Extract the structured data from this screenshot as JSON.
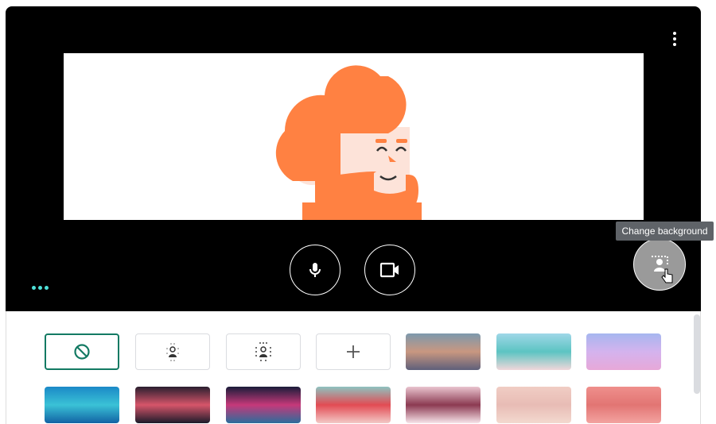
{
  "tooltip": "Change background",
  "icons": {
    "menu": "more-vert-icon",
    "mic": "microphone-icon",
    "camera": "video-camera-icon",
    "background": "change-background-icon",
    "cursor": "hand-cursor-icon"
  },
  "colors": {
    "accent": "#137a63",
    "avatar_orange": "#ff8142",
    "dots": "#4ee0d8"
  },
  "backgrounds": {
    "options": [
      {
        "name": "no-effect",
        "icon": "block-icon",
        "selected": true
      },
      {
        "name": "slight-blur",
        "icon": "blur-small-icon"
      },
      {
        "name": "blur",
        "icon": "blur-large-icon"
      },
      {
        "name": "upload",
        "icon": "plus-icon"
      }
    ],
    "row1_images": [
      {
        "name": "sunset-gradient",
        "colors": [
          "#7d99ad",
          "#c99780",
          "#5e5f7a"
        ]
      },
      {
        "name": "beach",
        "colors": [
          "#9fd7e8",
          "#5cc4c2",
          "#f0d7da"
        ]
      },
      {
        "name": "purple-clouds",
        "colors": [
          "#a6b6ef",
          "#d4b3ee",
          "#e7a8d8"
        ]
      }
    ],
    "row2_images": [
      {
        "name": "pool-water",
        "colors": [
          "#1b89c7",
          "#3ac2d6",
          "#1262a4"
        ]
      },
      {
        "name": "galaxy",
        "colors": [
          "#2a1f2f",
          "#d6556a",
          "#1b1b2a"
        ]
      },
      {
        "name": "fireworks",
        "colors": [
          "#1a1c3a",
          "#c6397a",
          "#2a6e9c"
        ]
      },
      {
        "name": "flowers",
        "colors": [
          "#8ec3c0",
          "#e24b53",
          "#f3c9c6"
        ]
      },
      {
        "name": "blossoms",
        "colors": [
          "#e9c4cf",
          "#8c3a52",
          "#f7e4ea"
        ]
      },
      {
        "name": "pink-sparkle",
        "colors": [
          "#f0cdc4",
          "#e8bcb5",
          "#f3d9cf"
        ]
      },
      {
        "name": "pink-pattern",
        "colors": [
          "#ef8f8c",
          "#e27573",
          "#f3a3a0"
        ]
      }
    ]
  }
}
